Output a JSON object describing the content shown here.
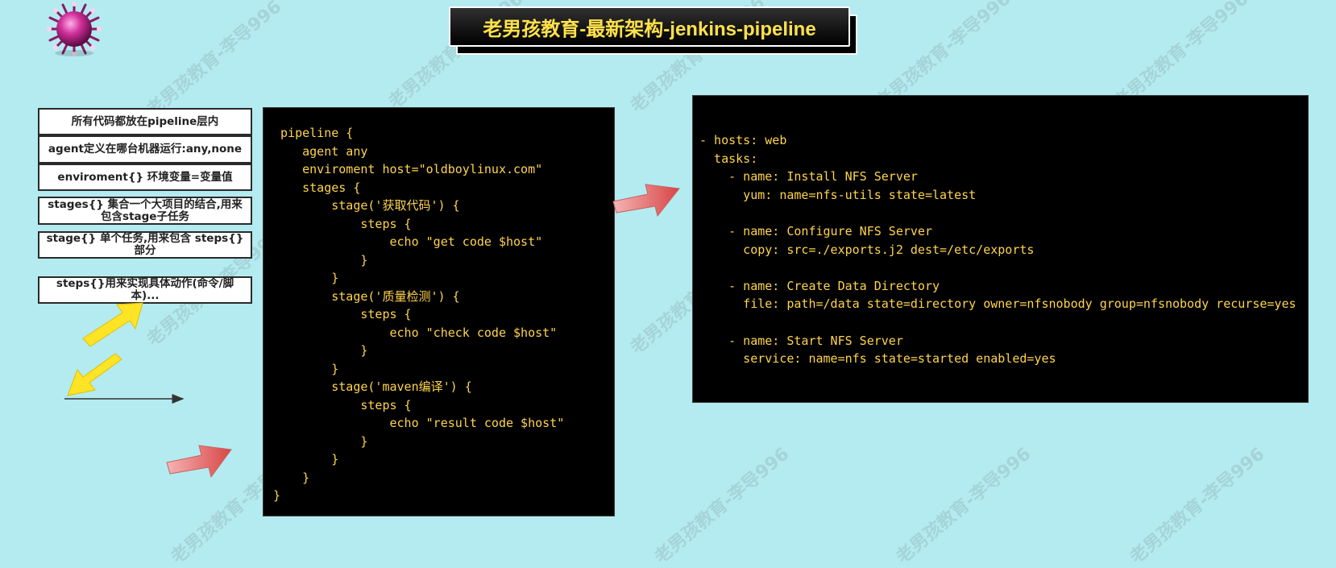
{
  "title": "老男孩教育-最新架构-jenkins-pipeline",
  "watermark": "老男孩教育-李导996",
  "legend": [
    "所有代码都放在pipeline层内",
    "agent定义在哪台机器运行:any,none",
    "enviroment{} 环境变量=变量值",
    "stages{}  集合一个大项目的结合,用来包含stage子任务",
    "stage{} 单个任务,用来包含 steps{}部分",
    "steps{}用来实现具体动作(命令/脚本)..."
  ],
  "pipeline_code": [
    " pipeline {",
    "    agent any",
    "    enviroment host=\"oldboylinux.com\"",
    "    stages {",
    "        stage('获取代码') {",
    "            steps {",
    "                echo \"get code $host\"",
    "            }",
    "        }",
    "        stage('质量检测') {",
    "            steps {",
    "                echo \"check code $host\"",
    "            }",
    "        }",
    "        stage('maven编译') {",
    "            steps {",
    "                echo \"result code $host\"",
    "            }",
    "        }",
    "    }",
    "}"
  ],
  "ansible_code": [
    "- hosts: web",
    "  tasks:",
    "    - name: Install NFS Server",
    "      yum: name=nfs-utils state=latest",
    "",
    "    - name: Configure NFS Server",
    "      copy: src=./exports.j2 dest=/etc/exports",
    "",
    "    - name: Create Data Directory",
    "      file: path=/data state=directory owner=nfsnobody group=nfsnobody recurse=yes",
    "",
    "    - name: Start NFS Server",
    "      service: name=nfs state=started enabled=yes"
  ],
  "colors": {
    "background": "#b3ebf0",
    "code_text": "#ffd44d",
    "title_text": "#ffe14a",
    "red_arrow": "#e06a6a",
    "yellow_arrow": "#ffe425"
  }
}
